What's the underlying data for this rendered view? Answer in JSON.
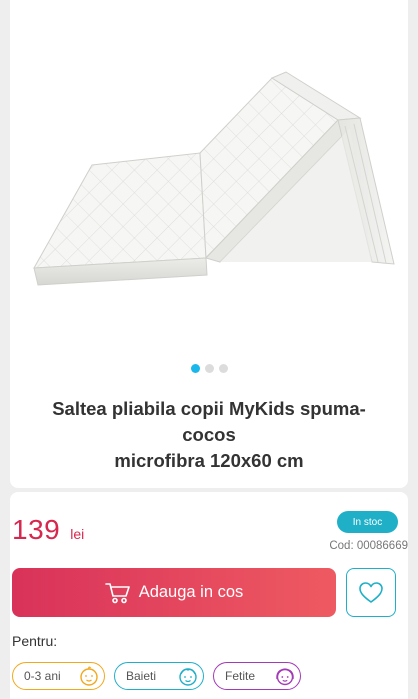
{
  "product": {
    "title_line1": "Saltea pliabila copii MyKids spuma-cocos",
    "title_line2": "microfibra 120x60 cm",
    "image_alt": "Saltea pliabila alba",
    "gallery_dots": 3,
    "active_dot": 0
  },
  "pricing": {
    "price": "139",
    "currency": "lei",
    "stock_label": "In stoc",
    "code": "Cod: 00086669"
  },
  "actions": {
    "add_to_cart_label": "Adauga in cos",
    "wishlist_icon": "heart-icon",
    "cart_icon": "cart-icon"
  },
  "audience": {
    "label": "Pentru:",
    "chips": [
      {
        "label": "0-3 ani",
        "icon": "baby-face-icon"
      },
      {
        "label": "Baieti",
        "icon": "boy-face-icon"
      },
      {
        "label": "Fetite",
        "icon": "girl-face-icon"
      }
    ]
  },
  "colors": {
    "accent_red": "#d6274f",
    "accent_teal": "#1fb0c8",
    "dot_active": "#1ab7ea",
    "chip_orange": "#f2a81d",
    "chip_purple": "#a33ab6"
  }
}
